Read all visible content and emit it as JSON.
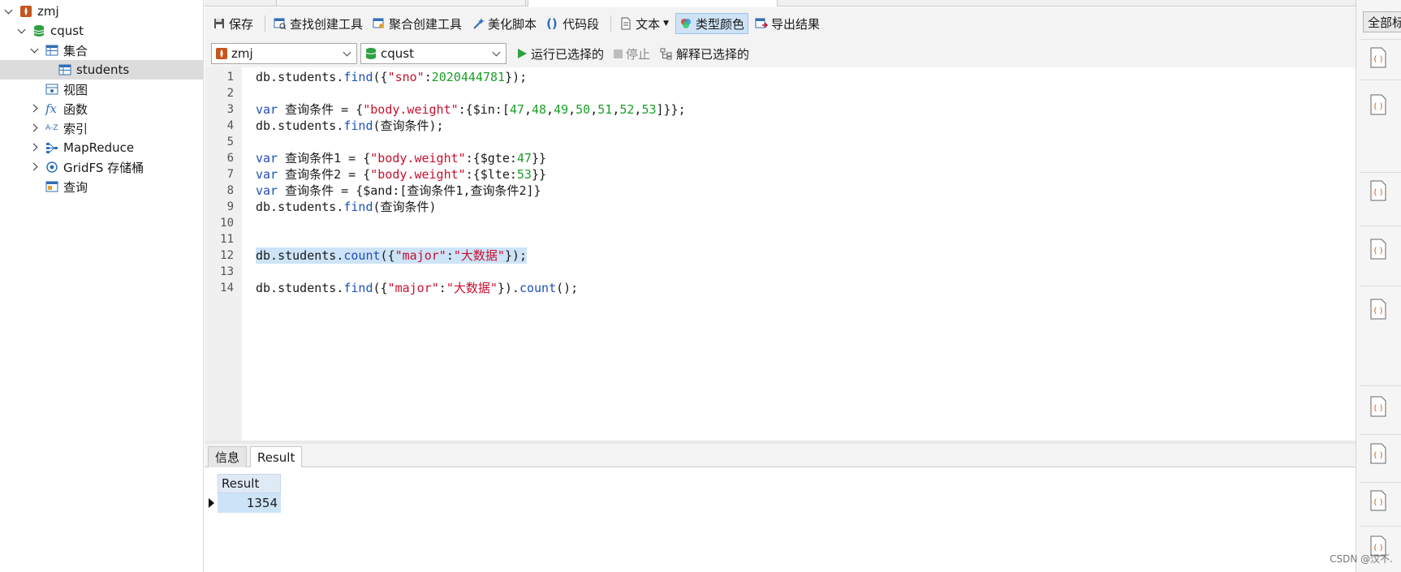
{
  "tree": {
    "connection": "zmj",
    "database": "cqust",
    "collections_group": "集合",
    "collection": "students",
    "views": "视图",
    "functions": "函数",
    "indexes": "索引",
    "mapreduce": "MapReduce",
    "gridfs": "GridFS 存储桶",
    "queries": "查询"
  },
  "toolbar": {
    "save": "保存",
    "find_builder": "查找创建工具",
    "aggregate_builder": "聚合创建工具",
    "beautify": "美化脚本",
    "snippet": "代码段",
    "text": "文本",
    "type_color": "类型颜色",
    "export": "导出结果"
  },
  "selectors": {
    "connection": "zmj",
    "database": "cqust",
    "run_selected": "运行已选择的",
    "stop": "停止",
    "explain_selected": "解释已选择的"
  },
  "editor": {
    "line_numbers": [
      "1",
      "2",
      "3",
      "4",
      "5",
      "6",
      "7",
      "8",
      "9",
      "10",
      "11",
      "12",
      "13",
      "14"
    ],
    "l1": {
      "a": "db.students.",
      "b": "find",
      "c": "({",
      "d": "\"sno\"",
      "e": ":",
      "f": "2020444781",
      "g": "});"
    },
    "l3": {
      "a": "var",
      "b": " 查询条件 = {",
      "c": "\"body.weight\"",
      "d": ":{$in:[",
      "n1": "47",
      "n2": "48",
      "n3": "49",
      "n4": "50",
      "n5": "51",
      "n6": "52",
      "n7": "53",
      "comma": ",",
      "e": "]}};"
    },
    "l4": {
      "a": "db.students.",
      "b": "find",
      "c": "(查询条件);"
    },
    "l6": {
      "a": "var",
      "b": " 查询条件1 = {",
      "c": "\"body.weight\"",
      "d": ":{$gte:",
      "e": "47",
      "f": "}}"
    },
    "l7": {
      "a": "var",
      "b": " 查询条件2 = {",
      "c": "\"body.weight\"",
      "d": ":{$lte:",
      "e": "53",
      "f": "}}"
    },
    "l8": {
      "a": "var",
      "b": " 查询条件 = {$and:[查询条件1,查询条件2]}"
    },
    "l9": {
      "a": "db.students.",
      "b": "find",
      "c": "(查询条件)"
    },
    "l12": {
      "a": "db.students.",
      "b": "count",
      "c": "({",
      "d": "\"major\"",
      "e": ":",
      "f": "\"大数据\"",
      "g": "});"
    },
    "l14": {
      "a": "db.students.",
      "b": "find",
      "c": "({",
      "d": "\"major\"",
      "e": ":",
      "f": "\"大数据\"",
      "g": "}).",
      "h": "count",
      "i": "();"
    }
  },
  "results": {
    "tab_info": "信息",
    "tab_result": "Result",
    "column_header": "Result",
    "value": "1354"
  },
  "right_panel": {
    "all_tags": "全部标"
  },
  "watermark": "CSDN @汉不."
}
